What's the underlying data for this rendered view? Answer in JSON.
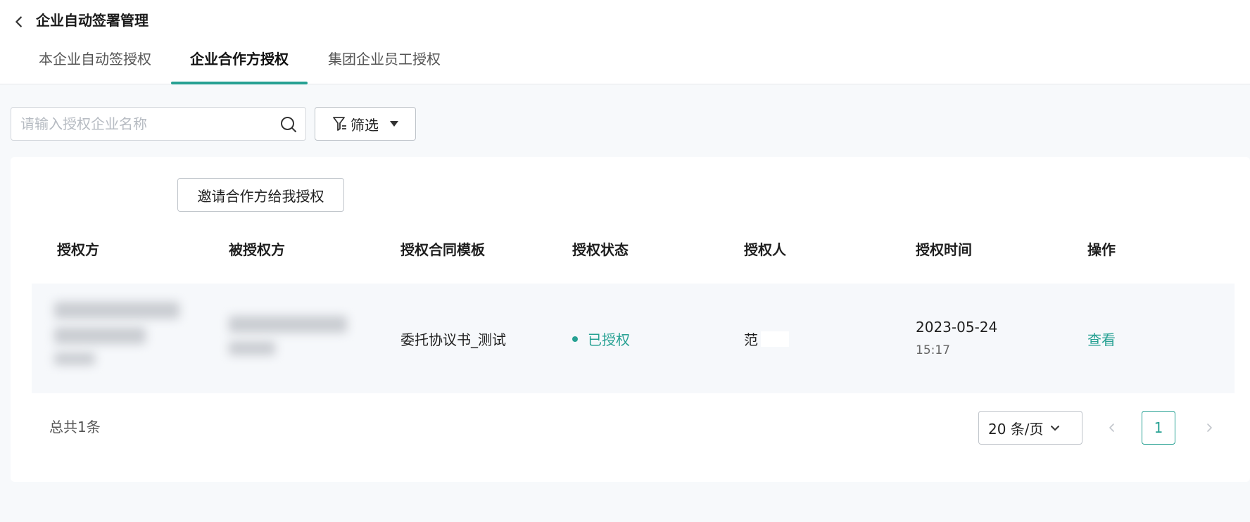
{
  "header": {
    "title": "企业自动签署管理",
    "back_icon": "chevron-left-icon"
  },
  "tabs": [
    {
      "label": "本企业自动签授权",
      "active": false
    },
    {
      "label": "企业合作方授权",
      "active": true
    },
    {
      "label": "集团企业员工授权",
      "active": false
    }
  ],
  "toolbar": {
    "search_placeholder": "请输入授权企业名称",
    "search_icon": "search-icon",
    "filter_label": "筛选",
    "filter_icon": "funnel-icon"
  },
  "invite_button": "邀请合作方给我授权",
  "table": {
    "columns": [
      "授权方",
      "被授权方",
      "授权合同模板",
      "授权状态",
      "授权人",
      "授权时间",
      "操作"
    ],
    "rows": [
      {
        "template": "委托协议书_测试",
        "status": "已授权",
        "authorizer": "范",
        "date": "2023-05-24",
        "time": "15:17",
        "action": "查看"
      }
    ]
  },
  "footer": {
    "total": "总共1条",
    "page_size": "20 条/页",
    "current_page": "1"
  },
  "colors": {
    "accent": "#27a193",
    "background": "#f7f9fb"
  }
}
